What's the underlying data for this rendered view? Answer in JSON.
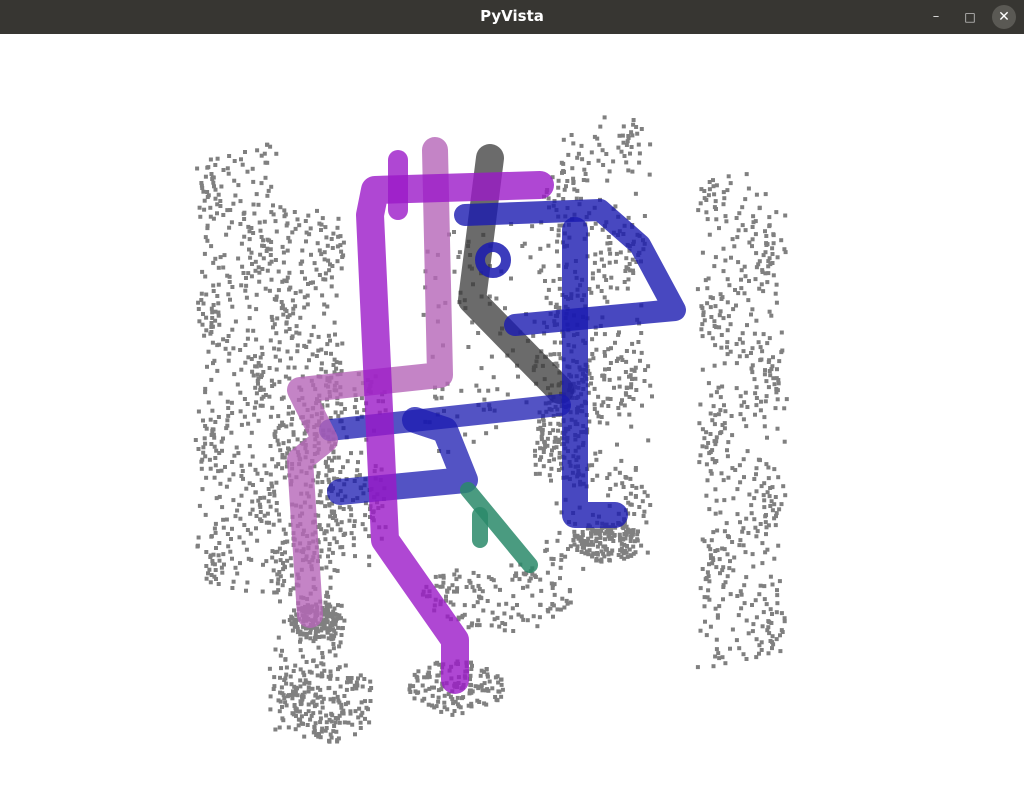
{
  "window": {
    "title": "PyVista",
    "buttons": {
      "minimize": "–",
      "maximize": "□",
      "close": "✕"
    }
  },
  "scene": {
    "background": "#ffffff",
    "point_color": "#808080",
    "pipe_colors": {
      "magenta": "#9b19c8",
      "pink": "#b565b8",
      "blue": "#1a1ab0",
      "dark": "#3a3a3a",
      "green": "#2a8a6a"
    }
  }
}
